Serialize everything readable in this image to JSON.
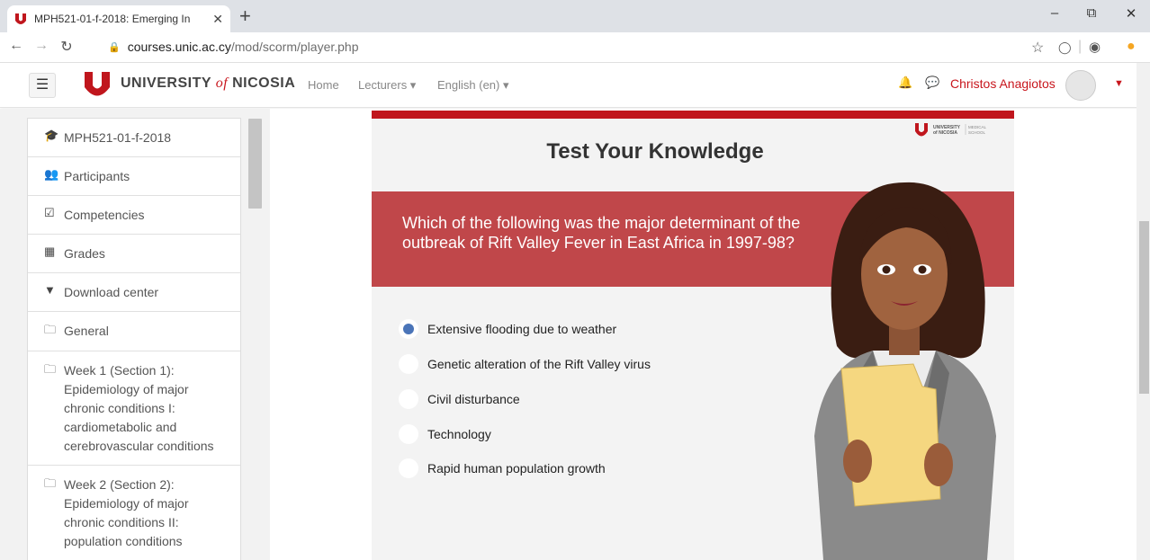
{
  "browser": {
    "tab_title": "MPH521-01-f-2018: Emerging In",
    "tab_close": "✕",
    "new_tab": "+",
    "url_host": "courses.unic.ac.cy",
    "url_path": "/mod/scorm/player.php"
  },
  "navbar": {
    "university_name_pre": "UNIVERSITY",
    "university_name_of": "of",
    "university_name_post": "NICOSIA",
    "links": [
      "Home",
      "Lecturers ▾",
      "English (en) ▾"
    ],
    "user_name": "Christos Anagiotos"
  },
  "sidebar": {
    "items": [
      {
        "icon": "graduation-cap-icon",
        "label": "MPH521-01-f-2018"
      },
      {
        "icon": "users-icon",
        "label": "Participants"
      },
      {
        "icon": "checkbox-icon",
        "label": "Competencies"
      },
      {
        "icon": "table-icon",
        "label": "Grades"
      },
      {
        "icon": "download-icon",
        "label": "Download center"
      },
      {
        "icon": "folder-icon",
        "label": "General"
      },
      {
        "icon": "folder-icon",
        "label": "Week 1 (Section 1): Epidemiology of major chronic conditions I: cardiometabolic and cerebrovascular conditions"
      },
      {
        "icon": "folder-icon",
        "label": "Week 2 (Section 2): Epidemiology of major chronic conditions II: population conditions"
      }
    ]
  },
  "quiz": {
    "heading": "Test Your Knowledge",
    "brand_line1": "UNIVERSITY",
    "brand_line2": "of NICOSIA",
    "brand_school_1": "MEDICAL",
    "brand_school_2": "SCHOOL",
    "question": "Which of the following was the major determinant of the outbreak of Rift Valley Fever in East Africa in 1997-98?",
    "options": [
      {
        "label": "Extensive flooding due to weather",
        "selected": true
      },
      {
        "label": "Genetic alteration of the Rift Valley virus",
        "selected": false
      },
      {
        "label": "Civil disturbance",
        "selected": false
      },
      {
        "label": "Technology",
        "selected": false
      },
      {
        "label": "Rapid human population growth",
        "selected": false
      }
    ]
  },
  "colors": {
    "brand_red": "#c0161d",
    "question_band": "#c0474a",
    "radio_selected": "#4a74b8"
  }
}
